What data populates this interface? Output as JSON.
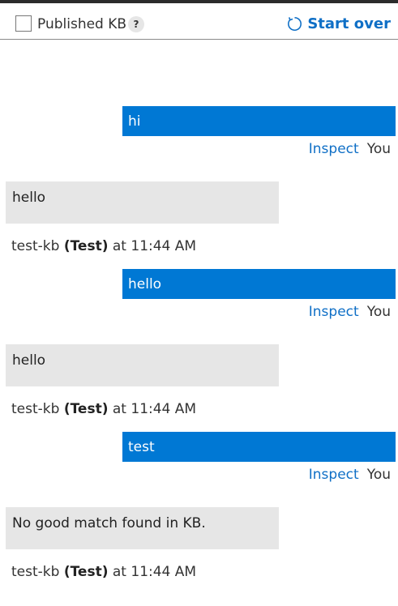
{
  "toolbar": {
    "kb_label": "Published KB",
    "help": "?",
    "start_over": "Start over"
  },
  "messages": [
    {
      "from": "user",
      "text": "hi",
      "inspect": "Inspect",
      "author": "You"
    },
    {
      "from": "bot",
      "text": "hello",
      "source": "test-kb",
      "env": "(Test)",
      "time": "at 11:44 AM"
    },
    {
      "from": "user",
      "text": "hello",
      "inspect": "Inspect",
      "author": "You"
    },
    {
      "from": "bot",
      "text": "hello",
      "source": "test-kb",
      "env": "(Test)",
      "time": "at 11:44 AM"
    },
    {
      "from": "user",
      "text": "test",
      "inspect": "Inspect",
      "author": "You"
    },
    {
      "from": "bot",
      "text": "No good match found in KB.",
      "source": "test-kb",
      "env": "(Test)",
      "time": "at 11:44 AM"
    }
  ],
  "colors": {
    "user_bubble": "#0078d4",
    "bot_bubble": "#e6e6e6",
    "link": "#0f6fc6"
  }
}
